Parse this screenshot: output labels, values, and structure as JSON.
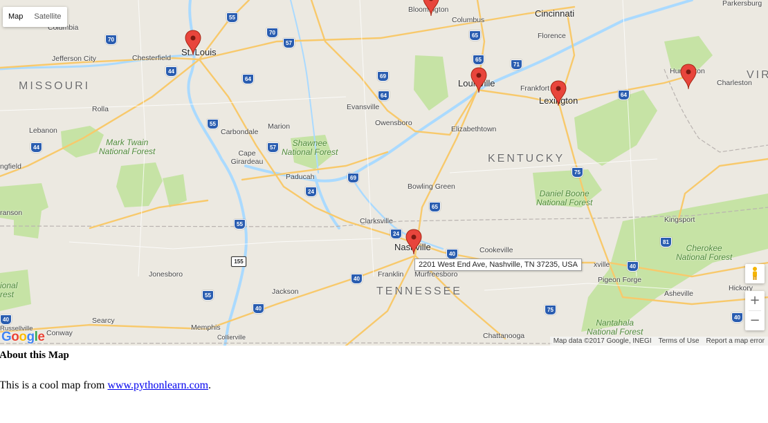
{
  "map_controls": {
    "type_map": "Map",
    "type_satellite": "Satellite",
    "zoom_in": "+",
    "zoom_out": "−"
  },
  "tooltip": "2201 West End Ave, Nashville, TN 37235, USA",
  "attribution": {
    "data": "Map data ©2017 Google, INEGI",
    "terms": "Terms of Use",
    "report": "Report a map error"
  },
  "logo": {
    "letters": [
      "G",
      "o",
      "o",
      "g",
      "l",
      "e"
    ],
    "colors": [
      "#4285F4",
      "#EA4335",
      "#FBBC05",
      "#4285F4",
      "#34A853",
      "#EA4335"
    ]
  },
  "colors": {
    "water": "#aadaff",
    "land": "#ece9e1",
    "forest": "#c6e3a5",
    "highway": "#f8c96b",
    "marker": "#e8453c",
    "link": "#0000ee"
  },
  "states": [
    "MISSOURI",
    "KENTUCKY",
    "TENNESSEE",
    "VIR"
  ],
  "cities_large": [
    "St. Louis",
    "Louisville",
    "Lexington",
    "Nashville",
    "Cincinnati"
  ],
  "cities_small": [
    "Bloomington",
    "Columbus",
    "Parkersburg",
    "Columbia",
    "Chesterfield",
    "Jefferson City",
    "Florence",
    "Frankfort",
    "Huntington",
    "Charleston",
    "Evansville",
    "Owensboro",
    "Elizabethtown",
    "Rolla",
    "Lebanon",
    "Carbondale",
    "Marion",
    "Cape Girardeau",
    "Paducah",
    "Bowling Green",
    "Clarksville",
    "Kingsport",
    "Cookeville",
    "Franklin",
    "Murfreesboro",
    "Jonesboro",
    "Jackson",
    "Memphis",
    "Collierville",
    "Searcy",
    "Conway",
    "Russellville",
    "Pigeon Forge",
    "Asheville",
    "Hickory",
    "Chattanooga",
    "ngfield",
    "ranson",
    "xville"
  ],
  "forests": [
    "Mark Twain\nNational Forest",
    "Shawnee\nNational Forest",
    "Daniel Boone\nNational Forest",
    "Cherokee\nNational Forest",
    "Nantahala\nNational Forest",
    "ional\nrest"
  ],
  "shields": [
    "55",
    "70",
    "70",
    "57",
    "44",
    "64",
    "69",
    "64",
    "65",
    "65",
    "71",
    "64",
    "55",
    "57",
    "44",
    "69",
    "24",
    "75",
    "65",
    "24",
    "40",
    "81",
    "40",
    "55",
    "155",
    "40",
    "40",
    "55",
    "75",
    "40",
    "40"
  ],
  "markers": [
    "Bloomington",
    "St. Louis",
    "Louisville",
    "Lexington",
    "Huntington",
    "Nashville"
  ],
  "about": {
    "heading": "About this Map",
    "text_before": "This is a cool map from ",
    "link_text": "www.pythonlearn.com",
    "text_after": "."
  }
}
